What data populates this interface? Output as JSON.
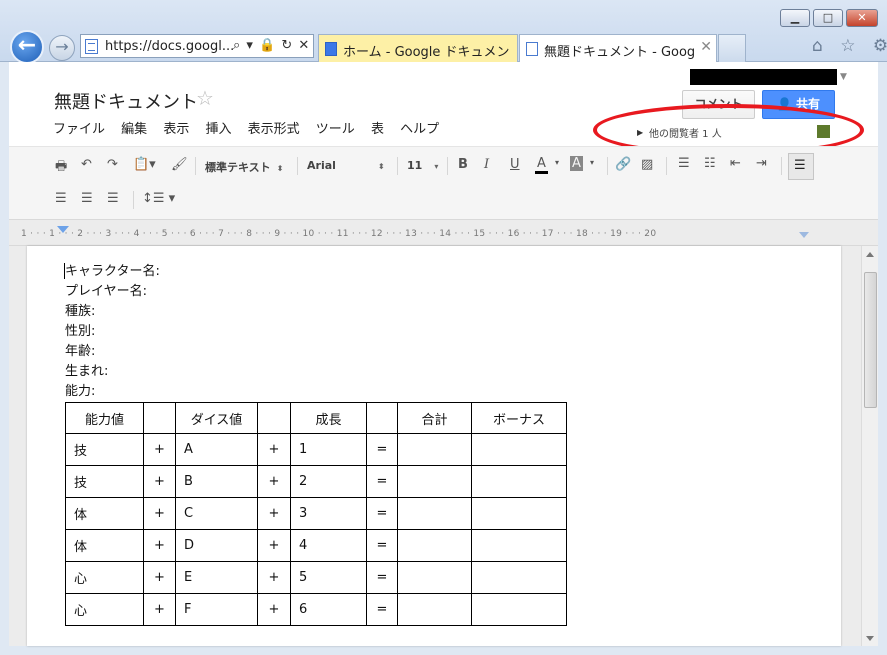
{
  "browser": {
    "window_controls": {
      "minimize": "▁",
      "maximize": "□",
      "close": "✕"
    },
    "address": "https://docs.googl...",
    "address_tools": "⌕ ▾ 🔒 ↻ ✕",
    "tabs": [
      {
        "label": "ホーム - Google ドキュメント"
      },
      {
        "label": "無題ドキュメント - Googl...",
        "close": "✕"
      }
    ],
    "toolbar_icons": "⌂ ☆ ⚙"
  },
  "docs": {
    "title": "無題ドキュメント",
    "star": "☆",
    "menu": [
      "ファイル",
      "編集",
      "表示",
      "挿入",
      "表示形式",
      "ツール",
      "表",
      "ヘルプ"
    ],
    "comment_button": "コメント",
    "share_button": "👤 共有",
    "viewers_text": "他の閲覧者 1 人",
    "viewer_color": "#5e7a2c",
    "annotation_color": "#e8191f"
  },
  "toolbar": {
    "paragraph_style": "標準テキスト",
    "font": "Arial",
    "font_size": "11"
  },
  "ruler": {
    "text": "1 · · · 1 · · · 2 · · · 3 · · · 4 · · · 5 · · · 6 · · · 7 · · · 8 · · · 9 · · · 10 · · · 11 · · · 12 · · · 13 · · · 14 · · · 15 · · · 16 · · · 17 · · · 18 · · · 19 · · · 20"
  },
  "document": {
    "lines": [
      "キャラクター名:",
      "プレイヤー名:",
      "種族:",
      "性別:",
      "年齢:",
      "生まれ:",
      "能力:"
    ],
    "table": {
      "header": [
        "能力値",
        "",
        "ダイス値",
        "",
        "成長",
        "",
        "合計",
        "ボーナス"
      ],
      "rows": [
        [
          "技",
          "+",
          "A",
          "+",
          "1",
          "=",
          "",
          ""
        ],
        [
          "技",
          "+",
          "B",
          "+",
          "2",
          "=",
          "",
          ""
        ],
        [
          "体",
          "+",
          "C",
          "+",
          "3",
          "=",
          "",
          ""
        ],
        [
          "体",
          "+",
          "D",
          "+",
          "4",
          "=",
          "",
          ""
        ],
        [
          "心",
          "+",
          "E",
          "+",
          "5",
          "=",
          "",
          ""
        ],
        [
          "心",
          "+",
          "F",
          "+",
          "6",
          "=",
          "",
          ""
        ]
      ]
    }
  }
}
